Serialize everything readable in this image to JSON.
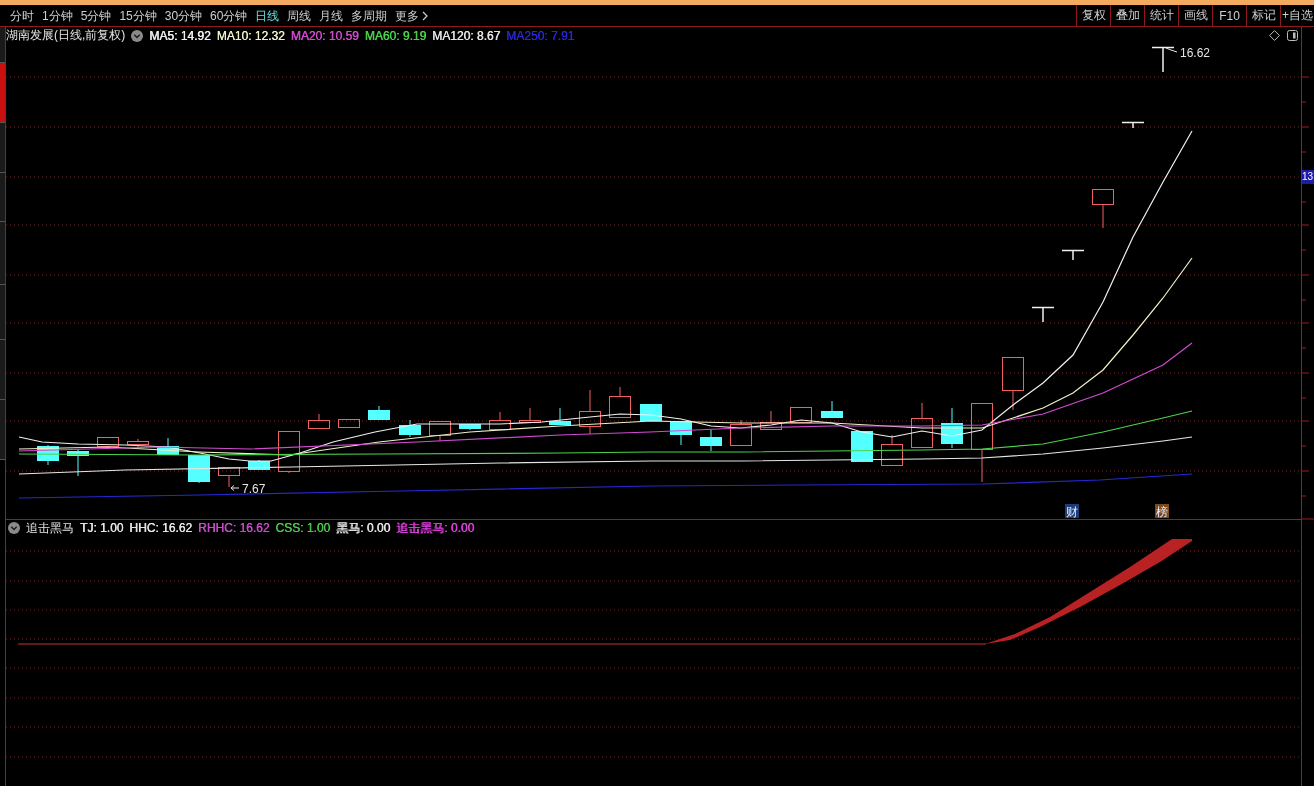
{
  "period_tabs": [
    {
      "label": "分时",
      "selected": false
    },
    {
      "label": "1分钟",
      "selected": false
    },
    {
      "label": "5分钟",
      "selected": false
    },
    {
      "label": "15分钟",
      "selected": false
    },
    {
      "label": "30分钟",
      "selected": false
    },
    {
      "label": "60分钟",
      "selected": false
    },
    {
      "label": "日线",
      "selected": true
    },
    {
      "label": "周线",
      "selected": false
    },
    {
      "label": "月线",
      "selected": false
    },
    {
      "label": "多周期",
      "selected": false
    }
  ],
  "more_menu": {
    "label": "更多"
  },
  "toolbar_buttons": [
    "复权",
    "叠加",
    "统计",
    "画线",
    "F10",
    "标记",
    "+自选"
  ],
  "side_tabs": [
    {
      "selected": false
    },
    {
      "selected": true
    },
    {
      "selected": false
    },
    {
      "selected": false
    },
    {
      "selected": false
    },
    {
      "selected": false
    },
    {
      "selected": false
    },
    {
      "selected": false
    }
  ],
  "main_chart": {
    "title": "湖南发展(日线,前复权)",
    "moving_averages": [
      {
        "label": "MA5: 14.92",
        "color": "#f0f0f0"
      },
      {
        "label": "MA10: 12.32",
        "color": "#f0f0c8"
      },
      {
        "label": "MA20: 10.59",
        "color": "#d24bd2"
      },
      {
        "label": "MA60: 9.19",
        "color": "#4bd24b"
      },
      {
        "label": "MA120: 8.67",
        "color": "#e6e6e6"
      },
      {
        "label": "MA250: 7.91",
        "color": "#2828d2"
      }
    ],
    "high_label": "16.62",
    "low_label": "7.67",
    "price_marker": "13",
    "event_markers": [
      {
        "label": "财",
        "color": "#1e3c78"
      },
      {
        "label": "榜",
        "color": "#7a4a1e"
      }
    ]
  },
  "indicator_panel": {
    "title": "追击黑马",
    "values": [
      {
        "label": "TJ: 1.00",
        "color": "#e6e6e6"
      },
      {
        "label": "HHC: 16.62",
        "color": "#e6e6e6"
      },
      {
        "label": "RHHC: 16.62",
        "color": "#c84bc8"
      },
      {
        "label": "CSS: 1.00",
        "color": "#4bc84b"
      },
      {
        "label": "黑马: 0.00",
        "color": "#e6e6e6"
      },
      {
        "label": "追击黑马: 0.00",
        "color": "#e040e0"
      }
    ]
  }
}
